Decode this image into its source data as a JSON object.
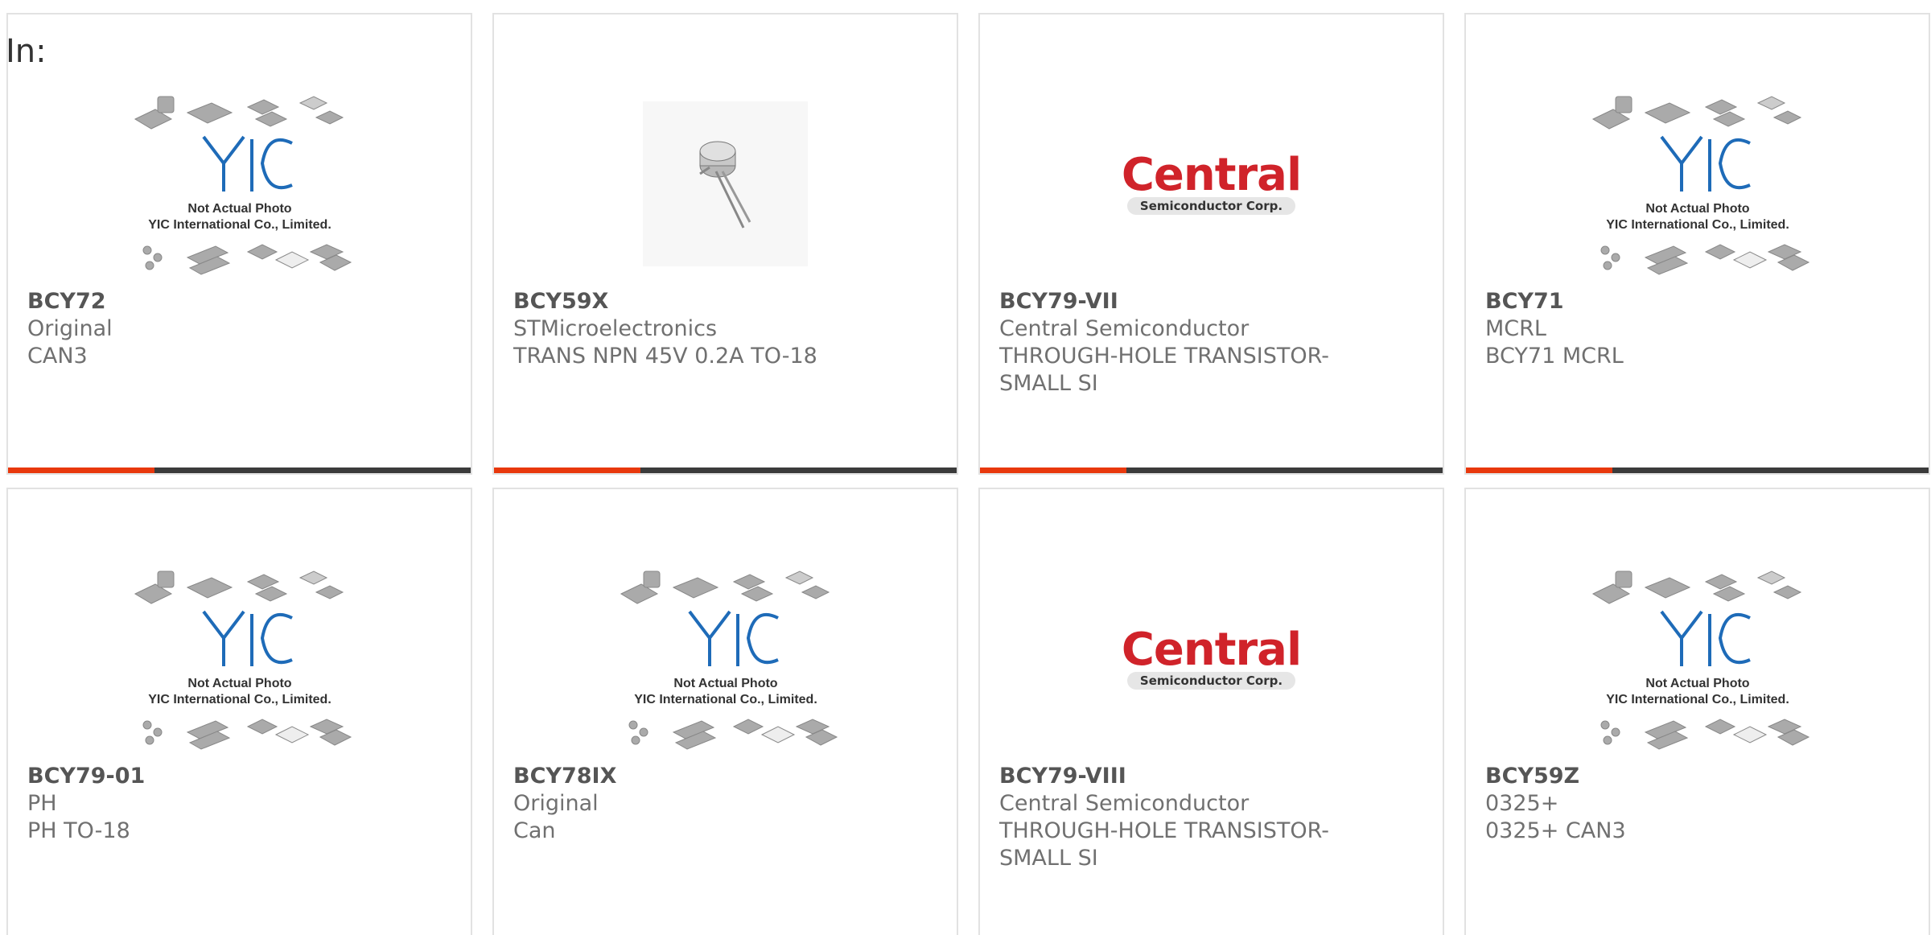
{
  "header": {
    "in_label": "In:"
  },
  "placeholder_image": {
    "line1": "Not Actual Photo",
    "line2": "YIC International Co., Limited.",
    "logo": "YIC"
  },
  "central_logo": {
    "big": "Central",
    "small": "Semiconductor Corp."
  },
  "colors": {
    "accent": "#e8380d",
    "bar": "#3b3b3b",
    "yic_blue": "#1e6bb8",
    "central_red": "#d0232a"
  },
  "products": [
    {
      "part": "BCY72",
      "manufacturer": "Original",
      "description": "CAN3",
      "image": "yic-placeholder"
    },
    {
      "part": "BCY59X",
      "manufacturer": "STMicroelectronics",
      "description": "TRANS NPN 45V 0.2A TO-18",
      "image": "to18-transistor-photo"
    },
    {
      "part": "BCY79-VII",
      "manufacturer": "Central Semiconductor",
      "description": "THROUGH-HOLE TRANSISTOR-SMALL SI",
      "image": "central-logo"
    },
    {
      "part": "BCY71",
      "manufacturer": "MCRL",
      "description": "BCY71 MCRL",
      "image": "yic-placeholder"
    },
    {
      "part": "BCY79-01",
      "manufacturer": "PH",
      "description": "PH TO-18",
      "image": "yic-placeholder"
    },
    {
      "part": "BCY78IX",
      "manufacturer": "Original",
      "description": "Can",
      "image": "yic-placeholder"
    },
    {
      "part": "BCY79-VIII",
      "manufacturer": "Central Semiconductor",
      "description": "THROUGH-HOLE TRANSISTOR-SMALL SI",
      "image": "central-logo"
    },
    {
      "part": "BCY59Z",
      "manufacturer": "0325+",
      "description": "0325+ CAN3",
      "image": "yic-placeholder"
    }
  ]
}
